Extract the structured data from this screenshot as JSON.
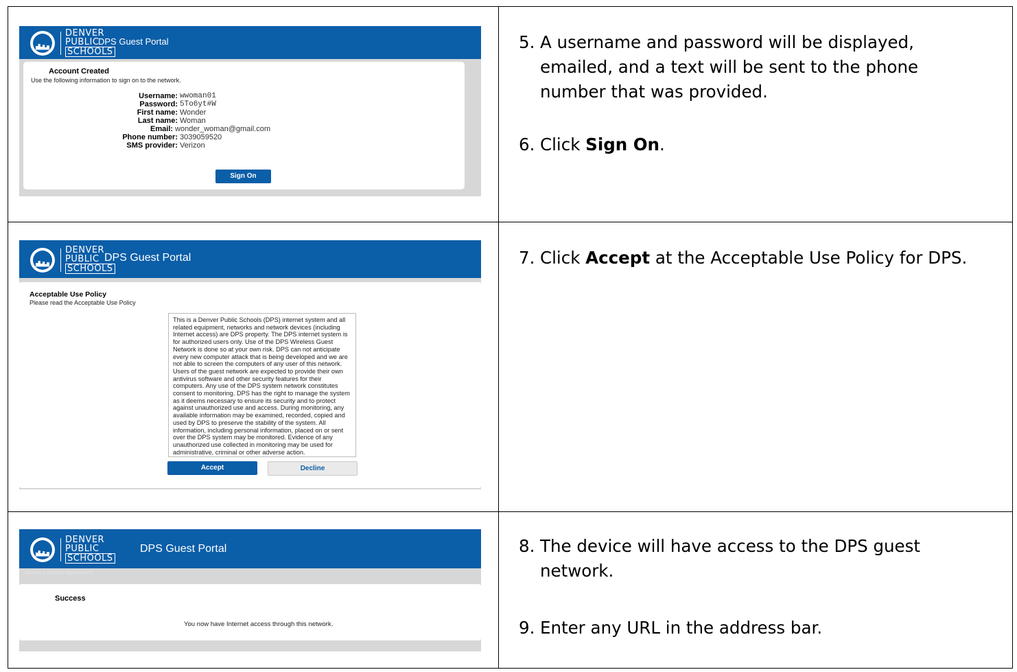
{
  "portal": {
    "logo_line1": "DENVER",
    "logo_line2": "PUBLIC",
    "logo_line3": "SCHOOLS",
    "title": "DPS Guest Portal",
    "tagline": "Discover a World of Opportunity™"
  },
  "rows": [
    {
      "steps": [
        {
          "number": "5.",
          "text": "A username and password will be displayed, emailed, and a text will be sent to the phone number that was provided."
        },
        {
          "number": "6.",
          "text_before": "Click ",
          "bold": "Sign On",
          "text_after": "."
        }
      ],
      "screen": {
        "heading": "Account Created",
        "subtitle": "Use the following information to sign on to the network.",
        "fields": [
          {
            "label": "Username:",
            "value": "wwoman01"
          },
          {
            "label": "Password:",
            "value": "5To6yt#W"
          },
          {
            "label": "First name:",
            "value": "Wonder"
          },
          {
            "label": "Last name:",
            "value": "Woman"
          },
          {
            "label": "Email:",
            "value": "wonder_woman@gmail.com"
          },
          {
            "label": "Phone number:",
            "value": "3039059520"
          },
          {
            "label": "SMS provider:",
            "value": "Verizon"
          }
        ],
        "button": "Sign On"
      }
    },
    {
      "steps": [
        {
          "number": "7.",
          "text_before": "Click ",
          "bold": "Accept",
          "text_after": " at the Acceptable Use Policy for DPS."
        }
      ],
      "screen": {
        "heading": "Acceptable Use Policy",
        "subtitle": "Please read the Acceptable Use Policy",
        "policy_text": "This is a Denver Public Schools (DPS) internet system and all related equipment, networks and network devices (including Internet access) are DPS property. The DPS internet system is for authorized users only. Use of the DPS Wireless Guest Network is done so at your own risk. DPS can not anticipate every new computer attack that is being developed and we are not able to screen the computers of any user of this network. Users of the guest network are expected to provide their own antivirus software and other security features for their computers. Any use of the DPS system network constitutes consent to monitoring. DPS has the right to manage the system as it deems necessary to ensure its security and to protect against unauthorized use and access. During monitoring, any available information may be examined, recorded, copied and used by DPS to preserve the stability of the system. All information, including personal information, placed on or sent over the DPS system may be monitored. Evidence of any unauthorized use collected in monitoring may be used for administrative, criminal or other adverse action.",
        "accept": "Accept",
        "decline": "Decline"
      }
    },
    {
      "steps": [
        {
          "number": "8.",
          "text": "The device will have access to the DPS guest network."
        },
        {
          "number": "9.",
          "text": "Enter any URL in the address bar."
        }
      ],
      "screen": {
        "heading": "Success",
        "message": "You now have Internet access through this network."
      }
    }
  ]
}
